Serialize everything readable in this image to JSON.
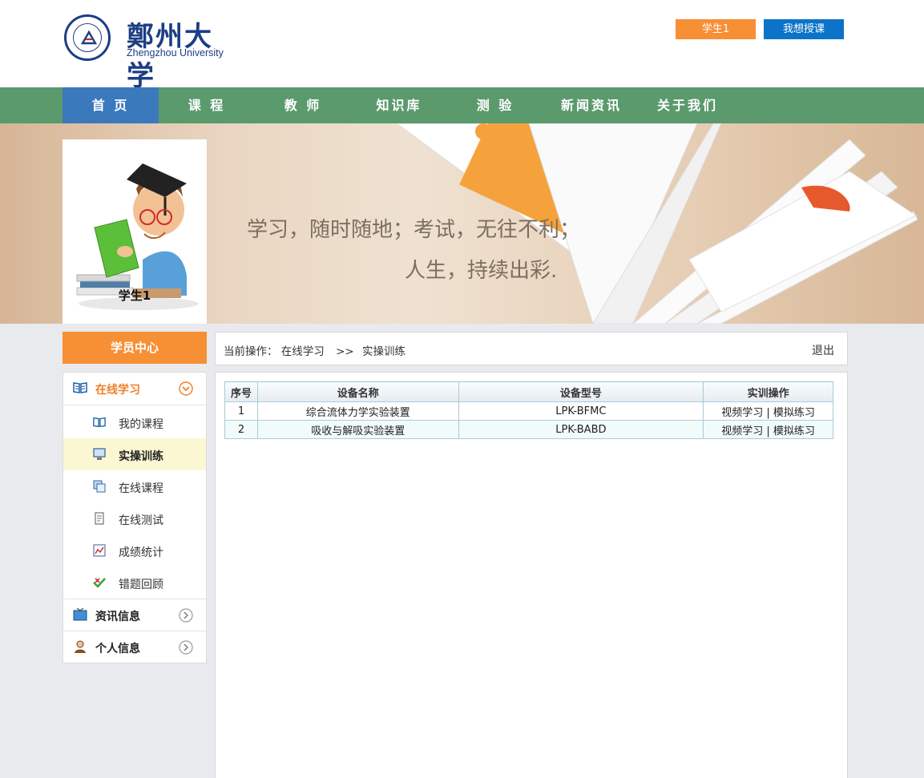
{
  "header": {
    "logo_cn": "鄭州大学",
    "logo_en": "Zhengzhou University",
    "user_button": "学生1",
    "teach_button": "我想授课"
  },
  "nav": {
    "items": [
      "首 页",
      "课 程",
      "教 师",
      "知识库",
      "测 验",
      "新闻资讯",
      "关于我们"
    ],
    "active_index": 0
  },
  "banner": {
    "user_name": "学生1",
    "slogan_line1": "学习，随时随地；考试，无往不利；",
    "slogan_line2": "人生，持续出彩."
  },
  "sidebar": {
    "title": "学员中心",
    "groups": [
      {
        "label": "在线学习",
        "icon": "book-icon",
        "expanded": true,
        "items": [
          {
            "label": "我的课程",
            "icon": "book-icon"
          },
          {
            "label": "实操训练",
            "icon": "computer-icon",
            "active": true
          },
          {
            "label": "在线课程",
            "icon": "window-icon"
          },
          {
            "label": "在线测试",
            "icon": "document-icon"
          },
          {
            "label": "成绩统计",
            "icon": "chart-icon"
          },
          {
            "label": "错题回顾",
            "icon": "check-icon"
          }
        ]
      },
      {
        "label": "资讯信息",
        "icon": "tv-icon",
        "expanded": false
      },
      {
        "label": "个人信息",
        "icon": "person-icon",
        "expanded": false
      }
    ]
  },
  "breadcrumb": {
    "prefix": "当前操作：",
    "path1": "在线学习",
    "separator": ">>",
    "path2": "实操训练",
    "logout": "退出"
  },
  "table": {
    "headers": [
      "序号",
      "设备名称",
      "设备型号",
      "实训操作"
    ],
    "rows": [
      {
        "no": "1",
        "name": "综合流体力学实验装置",
        "model": "LPK-BFMC",
        "op1": "视频学习",
        "sep": "|",
        "op2": "模拟练习"
      },
      {
        "no": "2",
        "name": "吸收与解吸实验装置",
        "model": "LPK-BABD",
        "op1": "视频学习",
        "sep": "|",
        "op2": "模拟练习"
      }
    ]
  },
  "colors": {
    "nav_green": "#5b9a6c",
    "nav_active": "#3b79bd",
    "accent_orange": "#f78f35",
    "teach_blue": "#0b73c8"
  }
}
